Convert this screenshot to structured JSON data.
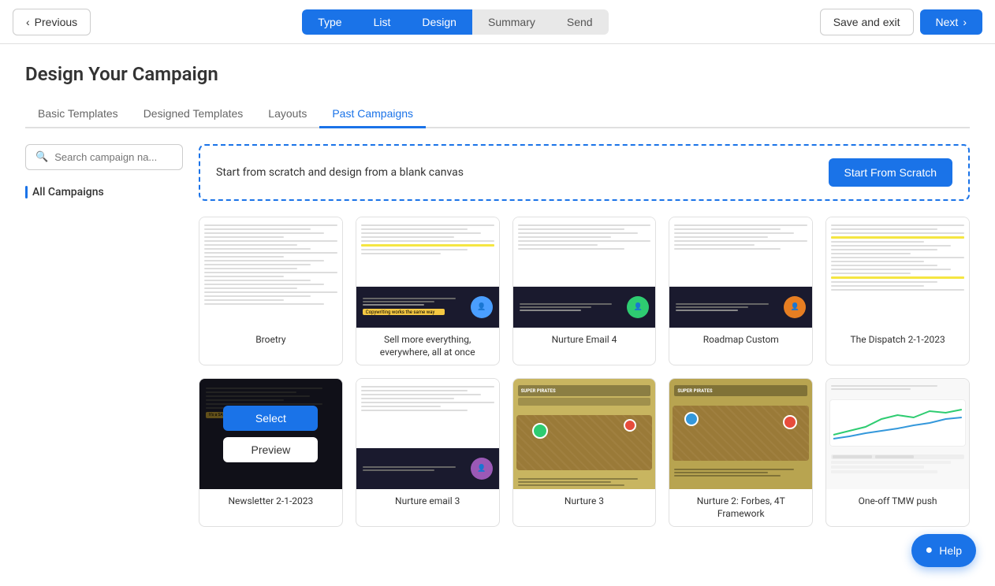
{
  "nav": {
    "prev_label": "Previous",
    "next_label": "Next",
    "save_exit_label": "Save and exit",
    "steps": [
      {
        "id": "type",
        "label": "Type",
        "state": "active"
      },
      {
        "id": "list",
        "label": "List",
        "state": "active"
      },
      {
        "id": "design",
        "label": "Design",
        "state": "active"
      },
      {
        "id": "summary",
        "label": "Summary",
        "state": "inactive"
      },
      {
        "id": "send",
        "label": "Send",
        "state": "inactive"
      }
    ]
  },
  "page": {
    "title": "Design Your Campaign"
  },
  "tabs": [
    {
      "id": "basic",
      "label": "Basic Templates",
      "active": false
    },
    {
      "id": "designed",
      "label": "Designed Templates",
      "active": false
    },
    {
      "id": "layouts",
      "label": "Layouts",
      "active": false
    },
    {
      "id": "past",
      "label": "Past Campaigns",
      "active": true
    }
  ],
  "sidebar": {
    "search_placeholder": "Search campaign na...",
    "filter_label": "All Campaigns"
  },
  "scratch_banner": {
    "text": "Start from scratch and design from a blank canvas",
    "btn_label": "Start From Scratch"
  },
  "templates": [
    {
      "id": 1,
      "name": "Broetry",
      "style": "text-light",
      "row": 1
    },
    {
      "id": 2,
      "name": "Sell more everything, everywhere, all at once",
      "style": "text-dark-bottom",
      "row": 1
    },
    {
      "id": 3,
      "name": "Nurture Email 4",
      "style": "text-dark-bottom",
      "row": 1
    },
    {
      "id": 4,
      "name": "Roadmap Custom",
      "style": "text-dark-bottom-alt",
      "row": 1
    },
    {
      "id": 5,
      "name": "The Dispatch 2-1-2023",
      "style": "text-light-highlight",
      "row": 1
    },
    {
      "id": 6,
      "name": "Newsletter 2-1-2023",
      "style": "text-dark-selected",
      "row": 2
    },
    {
      "id": 7,
      "name": "Nurture email 3",
      "style": "text-dark-bottom2",
      "row": 2
    },
    {
      "id": 8,
      "name": "Nurture 3",
      "style": "text-map",
      "row": 2
    },
    {
      "id": 9,
      "name": "Nurture 2: Forbes, 4T Framework",
      "style": "text-map-alt",
      "row": 2
    },
    {
      "id": 10,
      "name": "One-off TMW push",
      "style": "text-chart",
      "row": 2
    }
  ],
  "buttons": {
    "select": "Select",
    "preview": "Preview"
  },
  "help": {
    "label": "Help"
  }
}
